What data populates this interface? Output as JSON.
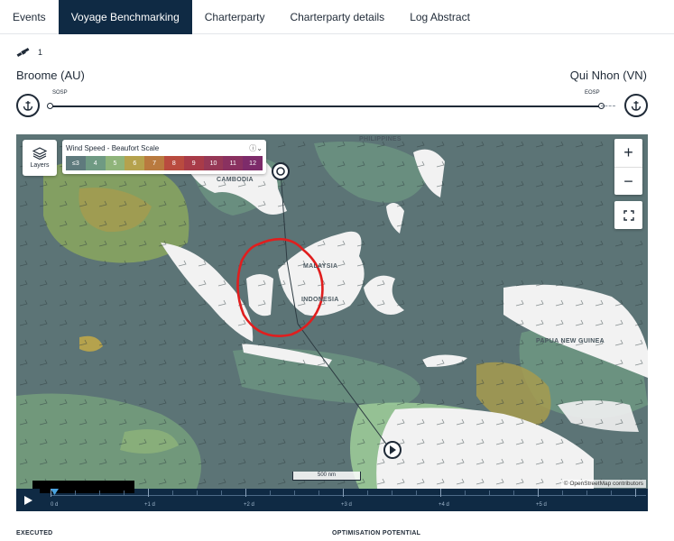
{
  "tabs": [
    {
      "label": "Events",
      "active": false
    },
    {
      "label": "Voyage Benchmarking",
      "active": true
    },
    {
      "label": "Charterparty",
      "active": false
    },
    {
      "label": "Charterparty details",
      "active": false
    },
    {
      "label": "Log Abstract",
      "active": false
    }
  ],
  "vessel": {
    "icon": "satellite-icon",
    "count": "1"
  },
  "voyage": {
    "from_port": "Broome (AU)",
    "to_port": "Qui Nhon (VN)",
    "start_marker": "SOSP",
    "end_marker": "EOSP"
  },
  "map": {
    "layers_label": "Layers",
    "legend": {
      "title": "Wind Speed - Beaufort Scale",
      "info_icon": "info-icon",
      "scale": [
        {
          "label": "≤3",
          "color": "#5f7a7d"
        },
        {
          "label": "4",
          "color": "#6f9a83"
        },
        {
          "label": "5",
          "color": "#8fb47a"
        },
        {
          "label": "6",
          "color": "#b5a24d"
        },
        {
          "label": "7",
          "color": "#b97a3f"
        },
        {
          "label": "8",
          "color": "#b94b3f"
        },
        {
          "label": "9",
          "color": "#a83b48"
        },
        {
          "label": "10",
          "color": "#963856"
        },
        {
          "label": "11",
          "color": "#8a3160"
        },
        {
          "label": "12",
          "color": "#7d2b6a"
        }
      ]
    },
    "zoom_in": "+",
    "zoom_out": "−",
    "place_labels": [
      "PHILIPPINES",
      "CAMBODIA",
      "MALAYSIA",
      "INDONESIA",
      "PAPUA NEW GUINEA"
    ],
    "scale_label": "500 nm",
    "attribution": "© OpenStreetMap contributors"
  },
  "timeline": {
    "labels": [
      "0 d",
      "+1 d",
      "+2 d",
      "+3 d",
      "+4 d",
      "+5 d"
    ]
  },
  "sections": {
    "executed": "EXECUTED",
    "optimisation": "OPTIMISATION POTENTIAL"
  },
  "colors": {
    "nav_dark": "#0f2a44",
    "sea": "#5c7476",
    "land": "#f2f2f2",
    "highlight_circle": "#e01e1e"
  }
}
